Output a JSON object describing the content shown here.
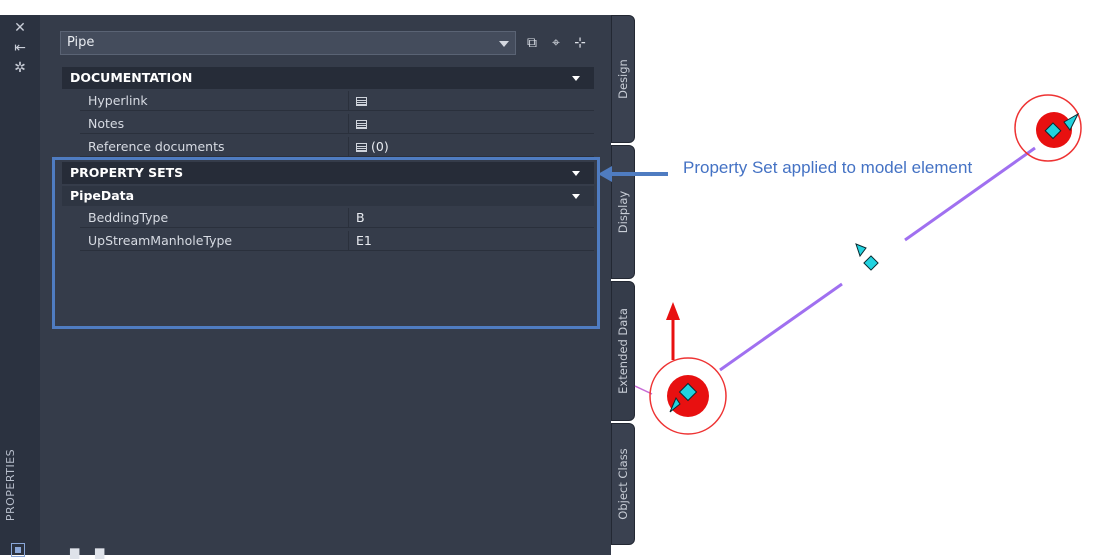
{
  "palette": {
    "title": "PROPERTIES",
    "strip_icons": [
      "close-icon",
      "auto-hide-icon",
      "settings-icon"
    ]
  },
  "header": {
    "object_type": "Pipe",
    "buttons": [
      "quick-select-icon",
      "pick-object-icon",
      "toggle-pickadd-icon"
    ]
  },
  "sections": {
    "documentation": {
      "title": "DOCUMENTATION",
      "rows": [
        {
          "name": "Hyperlink",
          "value": ""
        },
        {
          "name": "Notes",
          "value": ""
        },
        {
          "name": "Reference documents",
          "value": "(0)"
        }
      ]
    },
    "property_sets": {
      "title": "PROPERTY SETS",
      "group": "PipeData",
      "rows": [
        {
          "name": "BeddingType",
          "value": "B"
        },
        {
          "name": "UpStreamManholeType",
          "value": "E1"
        }
      ]
    }
  },
  "tabs": [
    {
      "label": "Design"
    },
    {
      "label": "Display"
    },
    {
      "label": "Extended Data"
    },
    {
      "label": "Object Class"
    }
  ],
  "annotation": {
    "text": "Property Set applied to model element",
    "color": "#4472c4"
  },
  "colors": {
    "panel_bg": "#353c4a",
    "highlight": "#4f7cc1",
    "pipe": "#a070f0",
    "manhole_fill": "#e81010",
    "marker": "#22d3e0"
  }
}
